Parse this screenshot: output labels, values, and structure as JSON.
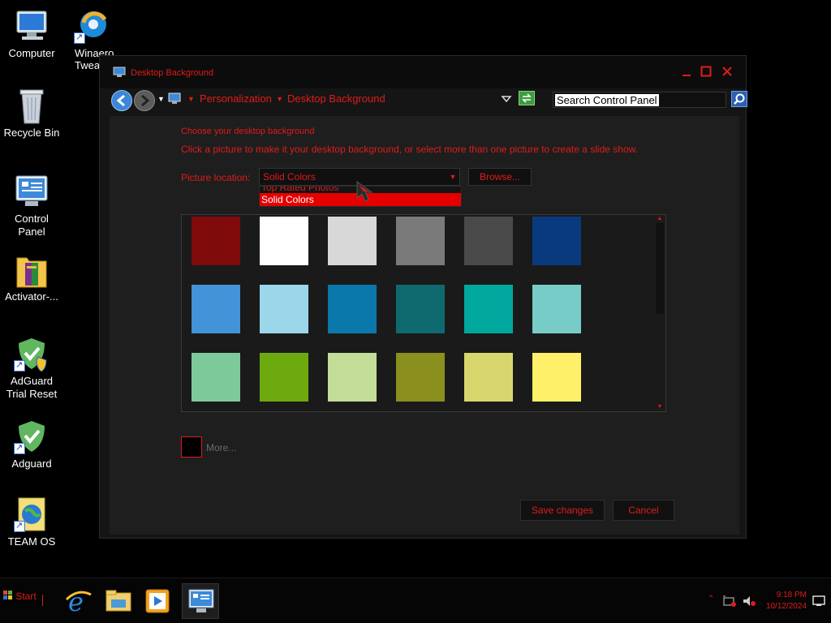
{
  "desktop": {
    "icons": [
      {
        "label": "Computer"
      },
      {
        "label": "Winaero Twea"
      },
      {
        "label": "Recycle Bin"
      },
      {
        "label": "Control Panel"
      },
      {
        "label": "Activator-..."
      },
      {
        "label": "AdGuard Trial Reset"
      },
      {
        "label": "Adguard"
      },
      {
        "label": "TEAM OS"
      }
    ]
  },
  "window": {
    "title": "Desktop Background",
    "breadcrumb": [
      "Personalization",
      "Desktop Background"
    ],
    "search_placeholder": "Search Control Panel",
    "heading": "Choose your desktop background",
    "instruction": "Click a picture to make it your desktop background, or select more than one picture to create a slide show.",
    "picture_location_label": "Picture location:",
    "picture_location_value": "Solid Colors",
    "browse_label": "Browse...",
    "dropdown_options": [
      "Top Rated Photos",
      "Solid Colors"
    ],
    "selected_option": "Solid Colors",
    "swatches": [
      [
        "#7e0a0a",
        "#ffffff",
        "#d8d8d8",
        "#7a7a7a",
        "#4a4a4a",
        "#0a3a7e"
      ],
      [
        "#4393d9",
        "#9cd6ea",
        "#0a78aa",
        "#0e6a6e",
        "#00a89e",
        "#78ccc8"
      ],
      [
        "#7ec99a",
        "#6caa10",
        "#c2dd98",
        "#8a8f1e",
        "#d8d76e",
        "#fff06a"
      ]
    ],
    "more_label": "More...",
    "save_label": "Save changes",
    "cancel_label": "Cancel"
  },
  "taskbar": {
    "start_label": "Start",
    "time": "9:18 PM",
    "date": "10/12/2024"
  },
  "colors": {
    "accent": "#e01b1b",
    "background": "#000000",
    "panel": "#1e1e1e"
  }
}
